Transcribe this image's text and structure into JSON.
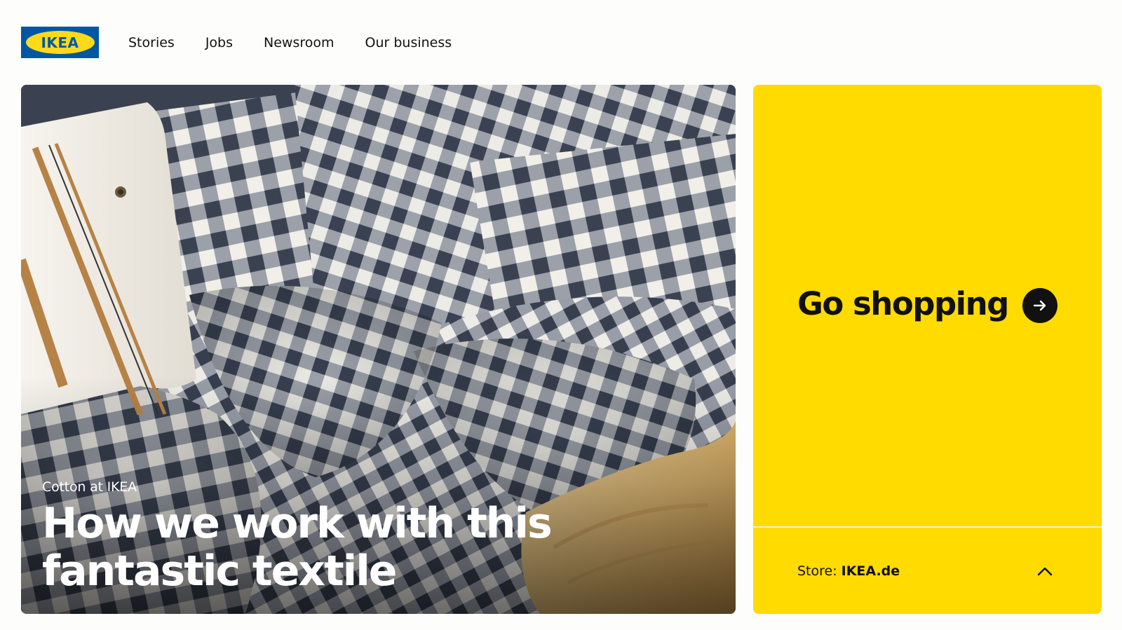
{
  "header": {
    "logo_text": "IKEA",
    "nav": [
      {
        "label": "Stories"
      },
      {
        "label": "Jobs"
      },
      {
        "label": "Newsroom"
      },
      {
        "label": "Our business"
      }
    ]
  },
  "hero": {
    "eyebrow": "Cotton at IKEA",
    "title": "How we work with this fantastic textile",
    "image_subject": "checkered-bedding-photo"
  },
  "shop_card": {
    "title": "Go shopping",
    "arrow_icon": "arrow-right-icon",
    "store_label": "Store:",
    "store_value": "IKEA.de",
    "toggle_icon": "chevron-up-icon"
  },
  "colors": {
    "brand_blue": "#0058a3",
    "brand_yellow": "#ffdb00",
    "text": "#111111",
    "page_background": "#fdfdfb"
  }
}
